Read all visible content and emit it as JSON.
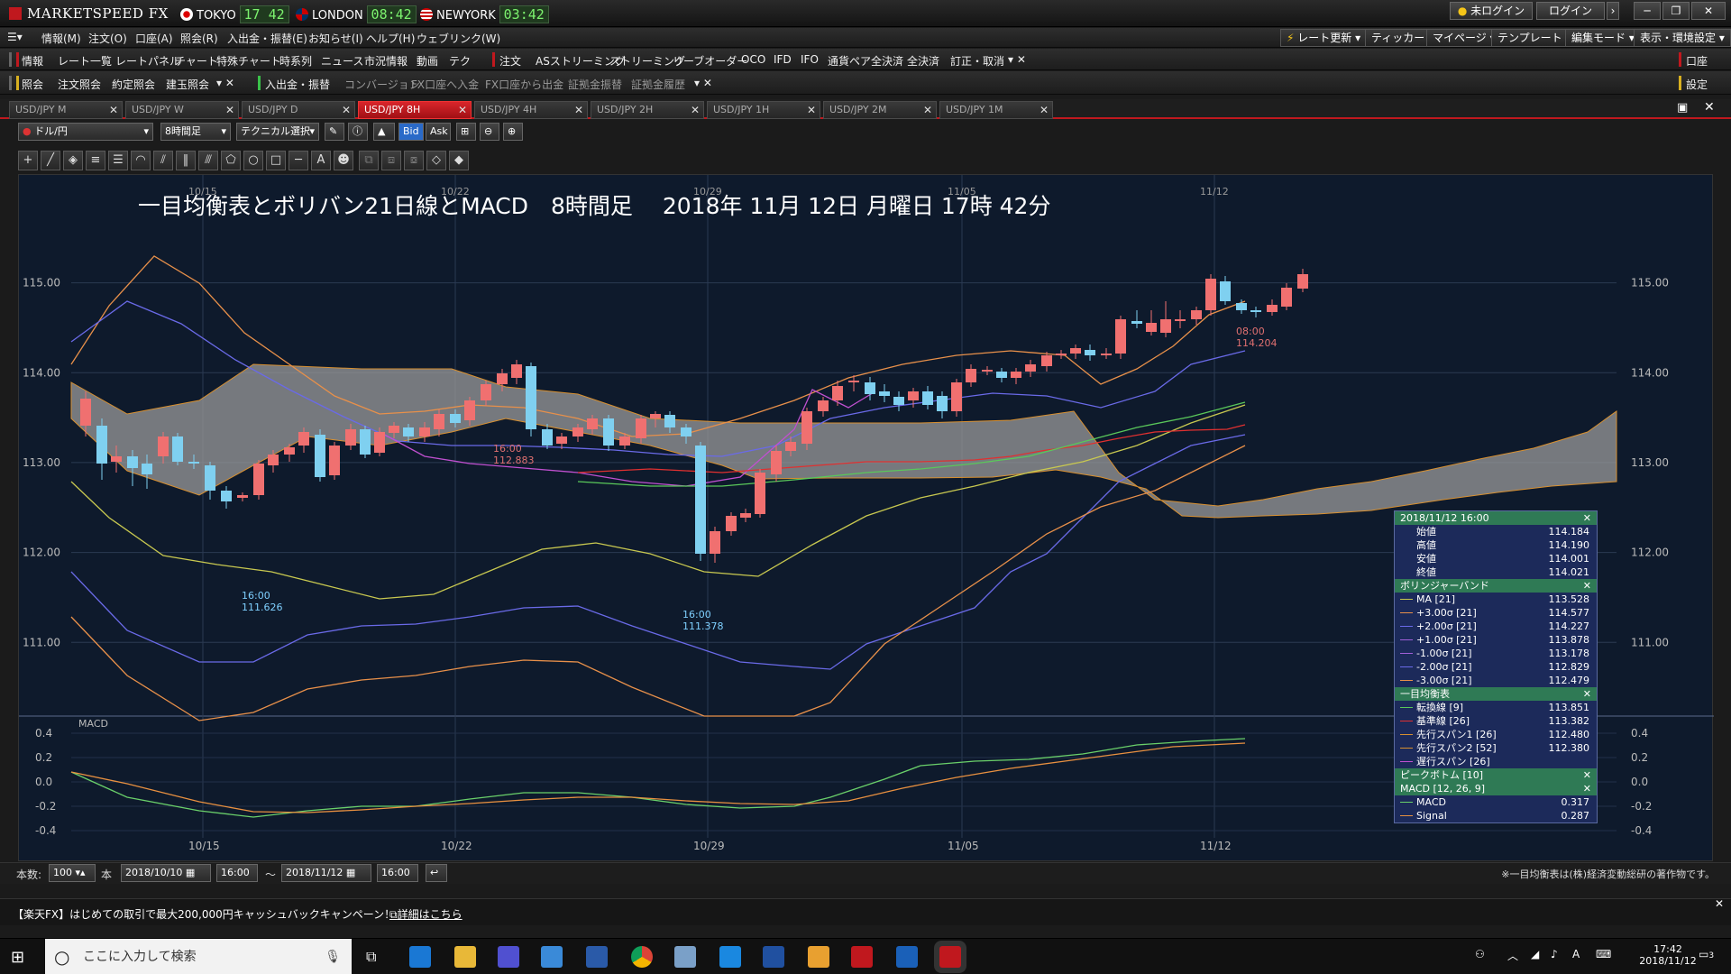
{
  "app": {
    "title": "MARKETSPEED FX",
    "clocks": [
      {
        "city": "TOKYO",
        "time": "17 42"
      },
      {
        "city": "LONDON",
        "time": "08:42"
      },
      {
        "city": "NEWYORK",
        "time": "03:42"
      }
    ],
    "login_status": "未ログイン",
    "login_button": "ログイン"
  },
  "menu": {
    "items": [
      "情報(M)",
      "注文(O)",
      "口座(A)",
      "照会(R)",
      "入出金・振替(E)",
      "お知らせ(I)",
      "ヘルプ(H)",
      "ウェブリンク(W)"
    ],
    "right": [
      "レート更新",
      "ティッカー",
      "マイページ",
      "テンプレート",
      "編集モード",
      "表示・環境設定"
    ]
  },
  "toolbar1": {
    "info_label": "情報",
    "items": [
      "レート一覧",
      "レートパネル",
      "チャート",
      "特殊チャート",
      "時系列",
      "ニュース",
      "市況情報",
      "動画",
      "テク"
    ],
    "order_label": "注文",
    "order_items": [
      "ASストリーミング",
      "ストリーミング",
      "リーブオーダー",
      "OCO",
      "IFD",
      "IFO",
      "通貨ペア全決済",
      "全決済",
      "訂正・取消"
    ],
    "right_label": "口座"
  },
  "toolbar2": {
    "inquiry_label": "照会",
    "items": [
      "注文照会",
      "約定照会",
      "建玉照会"
    ],
    "transfer_label": "入出金・振替",
    "transfer_items": [
      "コンバージョン",
      "FX口座へ入金",
      "FX口座から出金",
      "証拠金振替",
      "証拠金履歴"
    ],
    "right_label": "設定"
  },
  "tabs": [
    {
      "label": "USD/JPY M",
      "active": false
    },
    {
      "label": "USD/JPY W",
      "active": false
    },
    {
      "label": "USD/JPY D",
      "active": false
    },
    {
      "label": "USD/JPY 8H",
      "active": true
    },
    {
      "label": "USD/JPY 4H",
      "active": false
    },
    {
      "label": "USD/JPY 2H",
      "active": false
    },
    {
      "label": "USD/JPY 1H",
      "active": false
    },
    {
      "label": "USD/JPY 2M",
      "active": false
    },
    {
      "label": "USD/JPY 1M",
      "active": false
    }
  ],
  "chart_controls": {
    "pair": "ドル/円",
    "timeframe": "8時間足",
    "technical": "テクニカル選択",
    "bid": "Bid",
    "ask": "Ask"
  },
  "chart_data": {
    "type": "candlestick",
    "title": "一目均衡表とボリバン21日線とMACD　8時間足　 2018年 11月 12日 月曜日 17時 42分",
    "x_labels": [
      "10/15",
      "10/22",
      "10/29",
      "11/05",
      "11/12"
    ],
    "ylim": [
      110.2,
      116.2
    ],
    "y_ticks": [
      "115.00",
      "114.00",
      "113.00",
      "112.00",
      "111.00"
    ],
    "macd_ticks": [
      "0.4",
      "0.2",
      "0.0",
      "-0.2",
      "-0.4"
    ],
    "annotations": [
      {
        "time": "16:00",
        "price": "111.626"
      },
      {
        "time": "16:00",
        "price": "112.883"
      },
      {
        "time": "16:00",
        "price": "111.378"
      },
      {
        "time": "08:00",
        "price": "114.204"
      }
    ],
    "macd_label": "MACD"
  },
  "panel": {
    "date": "2018/11/12 16:00",
    "ohlc": [
      {
        "label": "始値",
        "value": "114.184"
      },
      {
        "label": "高値",
        "value": "114.190"
      },
      {
        "label": "安値",
        "value": "114.001"
      },
      {
        "label": "終値",
        "value": "114.021"
      }
    ],
    "bb_title": "ボリンジャーバンド",
    "bb": [
      {
        "label": "MA [21]",
        "value": "113.528",
        "color": "#c8c850"
      },
      {
        "label": "+3.00σ [21]",
        "value": "114.577",
        "color": "#e8904a"
      },
      {
        "label": "+2.00σ [21]",
        "value": "114.227",
        "color": "#6a6ae8"
      },
      {
        "label": "+1.00σ [21]",
        "value": "113.878",
        "color": "#a060d8"
      },
      {
        "label": "-1.00σ [21]",
        "value": "113.178",
        "color": "#a060d8"
      },
      {
        "label": "-2.00σ [21]",
        "value": "112.829",
        "color": "#6a6ae8"
      },
      {
        "label": "-3.00σ [21]",
        "value": "112.479",
        "color": "#e8904a"
      }
    ],
    "ichi_title": "一目均衡表",
    "ichi": [
      {
        "label": "転換線 [9]",
        "value": "113.851",
        "color": "#5ac85a"
      },
      {
        "label": "基準線 [26]",
        "value": "113.382",
        "color": "#e03030"
      },
      {
        "label": "先行スパン1 [26]",
        "value": "112.480",
        "color": "#d89030"
      },
      {
        "label": "先行スパン2 [52]",
        "value": "112.380",
        "color": "#d89030"
      },
      {
        "label": "遅行スパン [26]",
        "value": "",
        "color": "#c050d0"
      }
    ],
    "peak_title": "ピークボトム [10]",
    "macd_title": "MACD [12, 26, 9]",
    "macd": [
      {
        "label": "MACD",
        "value": "0.317",
        "color": "#6ad06a"
      },
      {
        "label": "Signal",
        "value": "0.287",
        "color": "#e89040"
      }
    ]
  },
  "bottom": {
    "count_label": "本数:",
    "count_value": "100",
    "count_unit": "本",
    "from_date": "2018/10/10",
    "from_time": "16:00",
    "tilde": "〜",
    "to_date": "2018/11/12",
    "to_time": "16:00",
    "copyright": "※一目均衡表は(株)経済変動総研の著作物です。"
  },
  "ad": {
    "text": "【楽天FX】はじめての取引で最大200,000円キャッシュバックキャンペーン！",
    "link": "詳細はこちら"
  },
  "taskbar": {
    "search_placeholder": "ここに入力して検索",
    "time": "17:42",
    "date": "2018/11/12",
    "ime": "A",
    "notif_count": "3"
  }
}
